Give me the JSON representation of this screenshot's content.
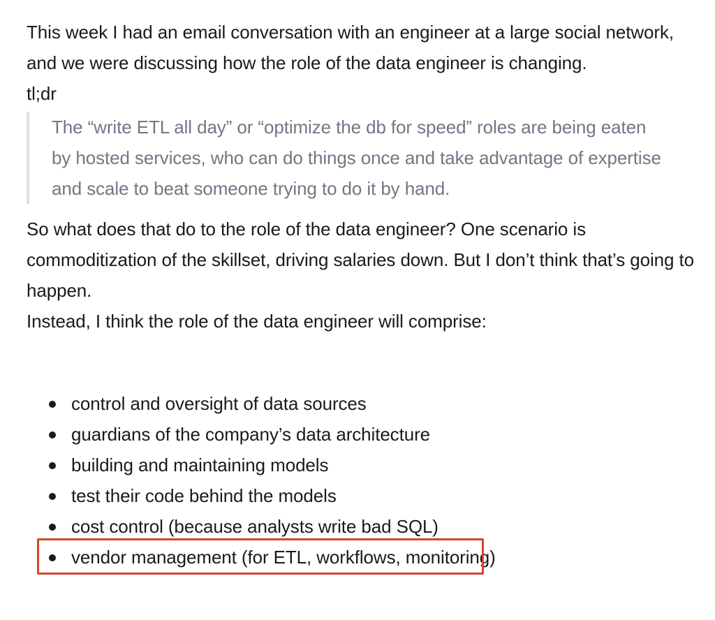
{
  "article": {
    "intro": "This week I had an email conversation with an engineer at a large social network, and we were discussing how the role of the data engineer is changing.",
    "tldr": "tl;dr",
    "quote": "The “write ETL all day” or “optimize the db for speed” roles are being eaten by hosted services, who can do things once and take advantage of expertise and scale to beat someone trying to do it by hand.",
    "paragraph2": "So what does that do to the role of the data engineer? One scenario is commoditization of the skillset, driving salaries down. But I don’t think that’s going to happen.",
    "paragraph3": "Instead, I think the role of the data engineer will comprise:",
    "list": [
      "control and oversight of data sources",
      "guardians of the company’s data architecture",
      "building and maintaining models",
      "test their code behind the models",
      "cost control (because analysts write bad SQL)",
      "vendor management (for ETL, workflows, monitoring)"
    ]
  },
  "colors": {
    "text": "#1a1a1a",
    "quote_text": "#707785",
    "quote_border": "#e0e0e6",
    "highlight": "#d6452f"
  }
}
